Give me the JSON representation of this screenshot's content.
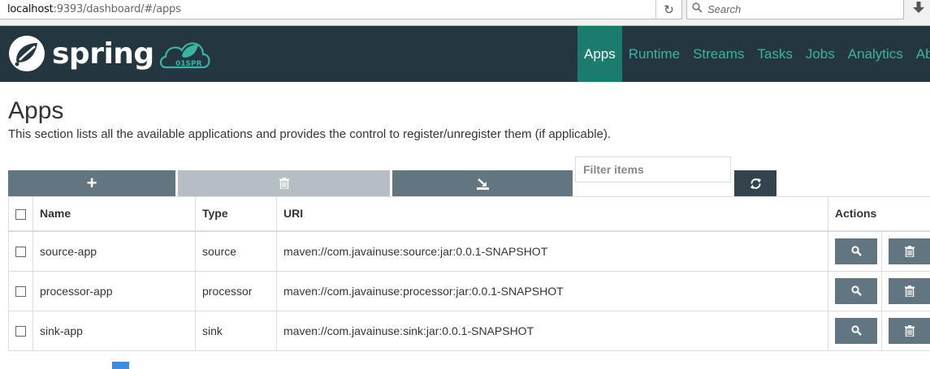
{
  "browser": {
    "url_host": "localhost",
    "url_rest": ":9393/dashboard/#/apps",
    "search_placeholder": "Search"
  },
  "header": {
    "logo_text": "spring",
    "badge_text": "01SPR",
    "nav": [
      {
        "label": "Apps",
        "active": true
      },
      {
        "label": "Runtime"
      },
      {
        "label": "Streams"
      },
      {
        "label": "Tasks"
      },
      {
        "label": "Jobs"
      },
      {
        "label": "Analytics"
      },
      {
        "label": "About"
      }
    ]
  },
  "page": {
    "title": "Apps",
    "description": "This section lists all the available applications and provides the control to register/unregister them (if applicable).",
    "filter_placeholder": "Filter items"
  },
  "toolbar": {
    "add_label": "+"
  },
  "table": {
    "columns": [
      "Name",
      "Type",
      "URI",
      "Actions"
    ],
    "rows": [
      {
        "name": "source-app",
        "type": "source",
        "uri": "maven://com.javainuse:source:jar:0.0.1-SNAPSHOT"
      },
      {
        "name": "processor-app",
        "type": "processor",
        "uri": "maven://com.javainuse:processor:jar:0.0.1-SNAPSHOT"
      },
      {
        "name": "sink-app",
        "type": "sink",
        "uri": "maven://com.javainuse:sink:jar:0.0.1-SNAPSHOT"
      }
    ]
  },
  "colors": {
    "header_bg": "#243640",
    "nav_link": "#3ab5a2",
    "nav_active_bg": "#1b7b6c",
    "button_bg": "#617681",
    "button_disabled_bg": "#b5bfc3",
    "refresh_bg": "#33444c"
  },
  "icons": {
    "reload": "reload-icon",
    "search": "magnifier-icon",
    "download": "download-arrow-icon",
    "logo": "spring-leaf-icon",
    "delete": "trash-icon",
    "import": "import-icon",
    "refresh": "refresh-icon",
    "view": "magnifier-icon"
  }
}
